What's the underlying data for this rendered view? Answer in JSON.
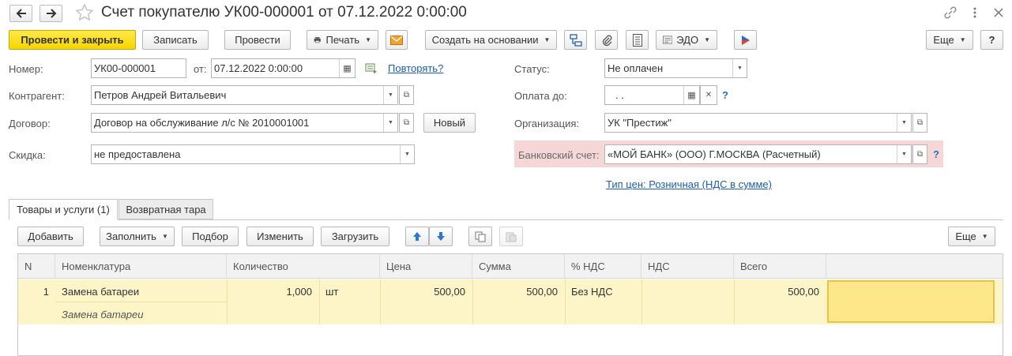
{
  "window": {
    "title": "Счет покупателю УК00-000001 от 07.12.2022 0:00:00",
    "menu_icon": "vertical-dots-icon",
    "close_icon": "close-icon"
  },
  "toolbar": {
    "post_close": "Провести и закрыть",
    "save": "Записать",
    "post": "Провести",
    "print": "Печать",
    "create_based": "Создать на основании",
    "edo": "ЭДО",
    "more": "Еще",
    "help": "?"
  },
  "form": {
    "number_label": "Номер:",
    "number_value": "УК00-000001",
    "from_label": "от:",
    "date_value": "07.12.2022  0:00:00",
    "repeat_link": "Повторять?",
    "counterparty_label": "Контрагент:",
    "counterparty_value": "Петров Андрей Витальевич",
    "contract_label": "Договор:",
    "contract_value": "Договор на обслуживание л/с № 2010001001",
    "new_button": "Новый",
    "discount_label": "Скидка:",
    "discount_value": "не предоставлена",
    "status_label": "Статус:",
    "status_value": "Не оплачен",
    "pay_until_label": "Оплата до:",
    "pay_until_value": " .  .",
    "org_label": "Организация:",
    "org_value": "УК \"Престиж\"",
    "bank_label": "Банковский счет:",
    "bank_value": "«МОЙ БАНК» (ООО) Г.МОСКВА (Расчетный)",
    "price_type_link": "Тип цен: Розничная (НДС в сумме)",
    "question": "?"
  },
  "tabs": [
    {
      "label": "Товары и услуги (1)",
      "active": true
    },
    {
      "label": "Возвратная тара",
      "active": false
    }
  ],
  "table_toolbar": {
    "add": "Добавить",
    "fill": "Заполнить",
    "pick": "Подбор",
    "edit": "Изменить",
    "load": "Загрузить",
    "more": "Еще"
  },
  "table": {
    "columns": [
      "N",
      "Номенклатура",
      "Количество",
      "Цена",
      "Сумма",
      "% НДС",
      "НДС",
      "Всего"
    ],
    "rows": [
      {
        "n": "1",
        "item": "Замена батареи",
        "item_desc": "Замена батареи",
        "qty": "1,000",
        "unit": "шт",
        "price": "500,00",
        "sum": "500,00",
        "vat_rate": "Без НДС",
        "vat": "",
        "total": "500,00"
      }
    ]
  },
  "colors": {
    "primary_button": "#f6d400",
    "row_highlight": "#fdf5c8",
    "selected_cell": "#fde789",
    "bank_highlight": "#f6d7d7",
    "link": "#1b5fb0"
  }
}
